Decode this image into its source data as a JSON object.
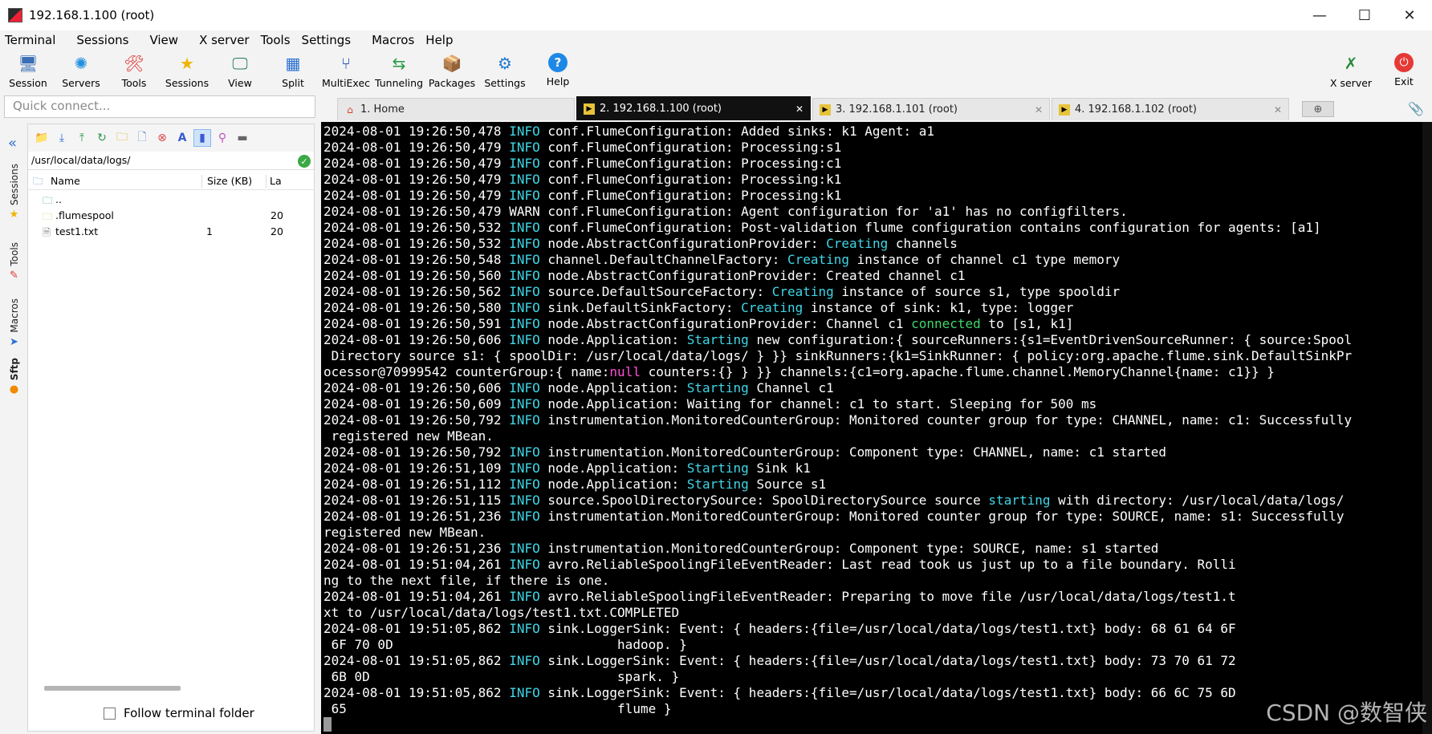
{
  "window": {
    "title": "192.168.1.100 (root)",
    "minimize": "—",
    "maximize": "☐",
    "close": "✕"
  },
  "menu": [
    "Terminal",
    "Sessions",
    "View",
    "X server",
    "Tools",
    "Settings",
    "Macros",
    "Help"
  ],
  "toolbar": {
    "items": [
      {
        "label": "Session",
        "icon": "session-icon",
        "glyph": "🖥"
      },
      {
        "label": "Servers",
        "icon": "servers-icon",
        "glyph": "✺"
      },
      {
        "label": "Tools",
        "icon": "tools-icon",
        "glyph": "🛠"
      },
      {
        "label": "Sessions",
        "icon": "star-icon",
        "glyph": "★"
      },
      {
        "label": "View",
        "icon": "view-icon",
        "glyph": "🖵"
      },
      {
        "label": "Split",
        "icon": "split-icon",
        "glyph": "▦"
      },
      {
        "label": "MultiExec",
        "icon": "multiexec-icon",
        "glyph": "⑂"
      },
      {
        "label": "Tunneling",
        "icon": "tunneling-icon",
        "glyph": "⇆"
      },
      {
        "label": "Packages",
        "icon": "packages-icon",
        "glyph": "📦"
      },
      {
        "label": "Settings",
        "icon": "settings-icon",
        "glyph": "⚙"
      },
      {
        "label": "Help",
        "icon": "help-icon",
        "glyph": "?"
      }
    ],
    "xserver": {
      "label": "X server",
      "glyph": "✗"
    },
    "exit": {
      "label": "Exit",
      "glyph": "⏻"
    }
  },
  "quick_connect": {
    "placeholder": "Quick connect..."
  },
  "tabs": [
    {
      "label": "1. Home",
      "active": false
    },
    {
      "label": "2. 192.168.1.100 (root)",
      "active": true
    },
    {
      "label": "3. 192.168.1.101 (root)",
      "active": false
    },
    {
      "label": "4. 192.168.1.102 (root)",
      "active": false
    }
  ],
  "side_tabs": [
    "Sessions",
    "Tools",
    "Macros",
    "Sftp"
  ],
  "sftp": {
    "path": "/usr/local/data/logs/",
    "columns": {
      "name": "Name",
      "size": "Size (KB)",
      "last": "La"
    },
    "files": [
      {
        "name": "..",
        "size": "",
        "last": ""
      },
      {
        "name": ".flumespool",
        "size": "",
        "last": "20"
      },
      {
        "name": "test1.txt",
        "size": "1",
        "last": "20"
      }
    ],
    "follow_label": "Follow terminal folder"
  },
  "terminal": {
    "lines": [
      [
        {
          "t": "2024-08-01 19:26:50,478 "
        },
        {
          "t": "INFO",
          "c": "info"
        },
        {
          "t": " conf.FlumeConfiguration: Added sinks: k1 Agent: a1"
        }
      ],
      [
        {
          "t": "2024-08-01 19:26:50,479 "
        },
        {
          "t": "INFO",
          "c": "info"
        },
        {
          "t": " conf.FlumeConfiguration: Processing:s1"
        }
      ],
      [
        {
          "t": "2024-08-01 19:26:50,479 "
        },
        {
          "t": "INFO",
          "c": "info"
        },
        {
          "t": " conf.FlumeConfiguration: Processing:c1"
        }
      ],
      [
        {
          "t": "2024-08-01 19:26:50,479 "
        },
        {
          "t": "INFO",
          "c": "info"
        },
        {
          "t": " conf.FlumeConfiguration: Processing:k1"
        }
      ],
      [
        {
          "t": "2024-08-01 19:26:50,479 "
        },
        {
          "t": "INFO",
          "c": "info"
        },
        {
          "t": " conf.FlumeConfiguration: Processing:k1"
        }
      ],
      [
        {
          "t": "2024-08-01 19:26:50,479 WARN conf.FlumeConfiguration: Agent configuration for 'a1' has no configfilters."
        }
      ],
      [
        {
          "t": "2024-08-01 19:26:50,532 "
        },
        {
          "t": "INFO",
          "c": "info"
        },
        {
          "t": " conf.FlumeConfiguration: Post-validation flume configuration contains configuration for agents: [a1]"
        }
      ],
      [
        {
          "t": "2024-08-01 19:26:50,532 "
        },
        {
          "t": "INFO",
          "c": "info"
        },
        {
          "t": " node.AbstractConfigurationProvider: "
        },
        {
          "t": "Creating",
          "c": "kw"
        },
        {
          "t": " channels"
        }
      ],
      [
        {
          "t": "2024-08-01 19:26:50,548 "
        },
        {
          "t": "INFO",
          "c": "info"
        },
        {
          "t": " channel.DefaultChannelFactory: "
        },
        {
          "t": "Creating",
          "c": "kw"
        },
        {
          "t": " instance of channel c1 type memory"
        }
      ],
      [
        {
          "t": "2024-08-01 19:26:50,560 "
        },
        {
          "t": "INFO",
          "c": "info"
        },
        {
          "t": " node.AbstractConfigurationProvider: Created channel c1"
        }
      ],
      [
        {
          "t": "2024-08-01 19:26:50,562 "
        },
        {
          "t": "INFO",
          "c": "info"
        },
        {
          "t": " source.DefaultSourceFactory: "
        },
        {
          "t": "Creating",
          "c": "kw"
        },
        {
          "t": " instance of source s1, type spooldir"
        }
      ],
      [
        {
          "t": "2024-08-01 19:26:50,580 "
        },
        {
          "t": "INFO",
          "c": "info"
        },
        {
          "t": " sink.DefaultSinkFactory: "
        },
        {
          "t": "Creating",
          "c": "kw"
        },
        {
          "t": " instance of sink: k1, type: logger"
        }
      ],
      [
        {
          "t": "2024-08-01 19:26:50,591 "
        },
        {
          "t": "INFO",
          "c": "info"
        },
        {
          "t": " node.AbstractConfigurationProvider: Channel c1 "
        },
        {
          "t": "connected",
          "c": "kwg"
        },
        {
          "t": " to [s1, k1]"
        }
      ],
      [
        {
          "t": "2024-08-01 19:26:50,606 "
        },
        {
          "t": "INFO",
          "c": "info"
        },
        {
          "t": " node.Application: "
        },
        {
          "t": "Starting",
          "c": "kw"
        },
        {
          "t": " new configuration:{ sourceRunners:{s1=EventDrivenSourceRunner: { source:Spool"
        }
      ],
      [
        {
          "t": " Directory source s1: { spoolDir: /usr/local/data/logs/ } }} sinkRunners:{k1=SinkRunner: { policy:org.apache.flume.sink.DefaultSinkPr"
        }
      ],
      [
        {
          "t": "ocessor@70999542 counterGroup:{ name:"
        },
        {
          "t": "null",
          "c": "kwm"
        },
        {
          "t": " counters:{} } }} channels:{c1=org.apache.flume.channel.MemoryChannel{name: c1}} }"
        }
      ],
      [
        {
          "t": "2024-08-01 19:26:50,606 "
        },
        {
          "t": "INFO",
          "c": "info"
        },
        {
          "t": " node.Application: "
        },
        {
          "t": "Starting",
          "c": "kw"
        },
        {
          "t": " Channel c1"
        }
      ],
      [
        {
          "t": "2024-08-01 19:26:50,609 "
        },
        {
          "t": "INFO",
          "c": "info"
        },
        {
          "t": " node.Application: Waiting for channel: c1 to start. Sleeping for 500 ms"
        }
      ],
      [
        {
          "t": "2024-08-01 19:26:50,792 "
        },
        {
          "t": "INFO",
          "c": "info"
        },
        {
          "t": " instrumentation.MonitoredCounterGroup: Monitored counter group for type: CHANNEL, name: c1: Successfully"
        }
      ],
      [
        {
          "t": " registered new MBean."
        }
      ],
      [
        {
          "t": "2024-08-01 19:26:50,792 "
        },
        {
          "t": "INFO",
          "c": "info"
        },
        {
          "t": " instrumentation.MonitoredCounterGroup: Component type: CHANNEL, name: c1 started"
        }
      ],
      [
        {
          "t": "2024-08-01 19:26:51,109 "
        },
        {
          "t": "INFO",
          "c": "info"
        },
        {
          "t": " node.Application: "
        },
        {
          "t": "Starting",
          "c": "kw"
        },
        {
          "t": " Sink k1"
        }
      ],
      [
        {
          "t": "2024-08-01 19:26:51,112 "
        },
        {
          "t": "INFO",
          "c": "info"
        },
        {
          "t": " node.Application: "
        },
        {
          "t": "Starting",
          "c": "kw"
        },
        {
          "t": " Source s1"
        }
      ],
      [
        {
          "t": "2024-08-01 19:26:51,115 "
        },
        {
          "t": "INFO",
          "c": "info"
        },
        {
          "t": " source.SpoolDirectorySource: SpoolDirectorySource source "
        },
        {
          "t": "starting",
          "c": "kw"
        },
        {
          "t": " with directory: /usr/local/data/logs/"
        }
      ],
      [
        {
          "t": "2024-08-01 19:26:51,236 "
        },
        {
          "t": "INFO",
          "c": "info"
        },
        {
          "t": " instrumentation.MonitoredCounterGroup: Monitored counter group for type: SOURCE, name: s1: Successfully"
        }
      ],
      [
        {
          "t": "registered new MBean."
        }
      ],
      [
        {
          "t": "2024-08-01 19:26:51,236 "
        },
        {
          "t": "INFO",
          "c": "info"
        },
        {
          "t": " instrumentation.MonitoredCounterGroup: Component type: SOURCE, name: s1 started"
        }
      ],
      [
        {
          "t": "2024-08-01 19:51:04,261 "
        },
        {
          "t": "INFO",
          "c": "info"
        },
        {
          "t": " avro.ReliableSpoolingFileEventReader: Last read took us just up to a file boundary. Rolli"
        }
      ],
      [
        {
          "t": "ng to the next file, if there is one."
        }
      ],
      [
        {
          "t": "2024-08-01 19:51:04,261 "
        },
        {
          "t": "INFO",
          "c": "info"
        },
        {
          "t": " avro.ReliableSpoolingFileEventReader: Preparing to move file /usr/local/data/logs/test1.t"
        }
      ],
      [
        {
          "t": "xt to /usr/local/data/logs/test1.txt.COMPLETED"
        }
      ],
      [
        {
          "t": "2024-08-01 19:51:05,862 "
        },
        {
          "t": "INFO",
          "c": "info"
        },
        {
          "t": " sink.LoggerSink: Event: { headers:{file=/usr/local/data/logs/test1.txt} body: 68 61 64 6F"
        }
      ],
      [
        {
          "t": " 6F 70 0D                             hadoop. }"
        }
      ],
      [
        {
          "t": "2024-08-01 19:51:05,862 "
        },
        {
          "t": "INFO",
          "c": "info"
        },
        {
          "t": " sink.LoggerSink: Event: { headers:{file=/usr/local/data/logs/test1.txt} body: 73 70 61 72"
        }
      ],
      [
        {
          "t": " 6B 0D                                spark. }"
        }
      ],
      [
        {
          "t": "2024-08-01 19:51:05,862 "
        },
        {
          "t": "INFO",
          "c": "info"
        },
        {
          "t": " sink.LoggerSink: Event: { headers:{file=/usr/local/data/logs/test1.txt} body: 66 6C 75 6D"
        }
      ],
      [
        {
          "t": " 65                                   flume }"
        }
      ]
    ],
    "colors": {
      "info": "#3fd6e6",
      "kw": "#3fd6e6",
      "kwg": "#3fd66a",
      "kwm": "#ff4fd8"
    }
  },
  "watermark": "CSDN @数智侠"
}
